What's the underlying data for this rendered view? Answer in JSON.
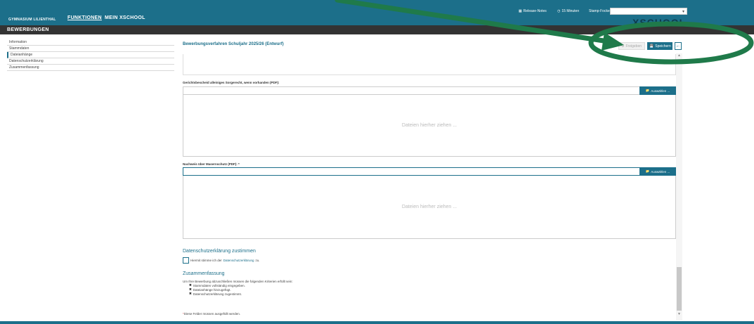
{
  "topbar": {
    "school": "Gymnasium Lilienthal",
    "nav": [
      "Funktionen",
      "Mein XSCHOOL"
    ],
    "release_notes": "Release-Notes",
    "session": "15 Minuten",
    "user": "Stamp-Focke, Stefan",
    "logo": "XSCHOOL"
  },
  "section": {
    "title": "Bewerbungen"
  },
  "sidebar": {
    "items": [
      {
        "label": "Information"
      },
      {
        "label": "Stammdaten"
      },
      {
        "label": "Dateianhänge"
      },
      {
        "label": "Datenschutzerklärung"
      },
      {
        "label": "Zusammenfassung"
      }
    ]
  },
  "main": {
    "title": "Bewerbungsverfahren Schuljahr 2025/26 (Entwurf)",
    "buttons": {
      "freigeben": "Freigeben",
      "speichern": "Speichern"
    },
    "fields": [
      {
        "label": "Gerichtsbescheid alleiniges Sorgerecht, wenn vorhanden (PDF):",
        "button": "Auswählen ...",
        "dropzone": "Dateien hierher ziehen ..."
      },
      {
        "label": "Nachweis über Masernschutz (PDF): *",
        "button": "Auswählen ...",
        "dropzone": "Dateien hierher ziehen ..."
      }
    ],
    "privacy": {
      "heading": "Datenschutzerklärung zustimmen",
      "text_before": "Hiermit stimme ich der",
      "link": "Datenschutzerklärung",
      "text_after": "zu."
    },
    "summary": {
      "heading": "Zusammenfassung",
      "intro": "Um Ihre Bewerbung abzuschließen müssen die folgenden Kriterien erfüllt sein:",
      "criteria": [
        "Stammdaten vollständig eingegeben.",
        "Dateianhänge hinzugefügt.",
        "Datenschutzerklärung zugestimmt."
      ],
      "footnote_star": "*",
      "footnote": "Diese Felder müssen ausgefüllt werden."
    }
  },
  "colors": {
    "primary": "#1c6f8a",
    "annotation": "#1f7a4a"
  }
}
